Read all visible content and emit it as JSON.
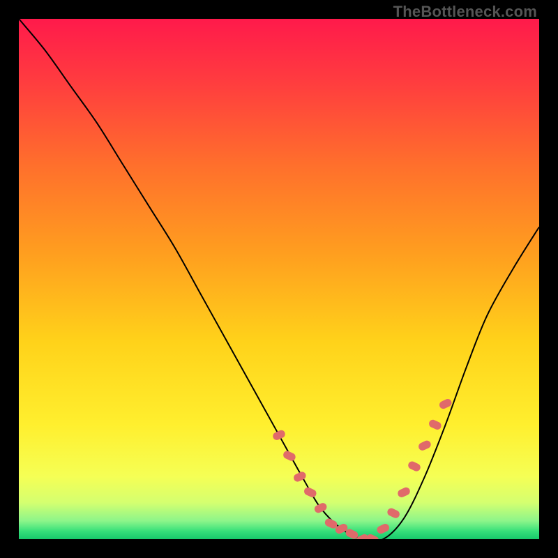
{
  "watermark": "TheBottleneck.com",
  "chart_data": {
    "type": "line",
    "title": "",
    "xlabel": "",
    "ylabel": "",
    "xlim": [
      0,
      100
    ],
    "ylim": [
      0,
      100
    ],
    "grid": false,
    "legend": false,
    "background": {
      "kind": "vertical-gradient",
      "stops": [
        {
          "pos": 0.0,
          "color": "#ff1a4b"
        },
        {
          "pos": 0.12,
          "color": "#ff3c3f"
        },
        {
          "pos": 0.28,
          "color": "#ff6f2c"
        },
        {
          "pos": 0.45,
          "color": "#ff9e1f"
        },
        {
          "pos": 0.62,
          "color": "#ffd21a"
        },
        {
          "pos": 0.78,
          "color": "#ffef2e"
        },
        {
          "pos": 0.88,
          "color": "#f5ff55"
        },
        {
          "pos": 0.93,
          "color": "#d4ff70"
        },
        {
          "pos": 0.965,
          "color": "#8cf58a"
        },
        {
          "pos": 0.985,
          "color": "#35e07a"
        },
        {
          "pos": 1.0,
          "color": "#17c96b"
        }
      ]
    },
    "series": [
      {
        "name": "curve",
        "color": "#000000",
        "width": 2,
        "x": [
          0,
          5,
          10,
          15,
          20,
          25,
          30,
          35,
          40,
          45,
          50,
          55,
          58,
          62,
          66,
          70,
          74,
          78,
          82,
          86,
          90,
          95,
          100
        ],
        "values": [
          100,
          94,
          87,
          80,
          72,
          64,
          56,
          47,
          38,
          29,
          20,
          11,
          6,
          2,
          0,
          0,
          4,
          12,
          22,
          33,
          43,
          52,
          60
        ]
      },
      {
        "name": "marker-band",
        "kind": "markers",
        "color": "#e06a6a",
        "size": 14,
        "x": [
          50,
          52,
          54,
          56,
          58,
          60,
          62,
          64,
          66,
          68,
          70,
          72,
          74,
          76,
          78,
          80,
          82
        ],
        "values": [
          20,
          16,
          12,
          9,
          6,
          3,
          2,
          1,
          0,
          0,
          2,
          5,
          9,
          14,
          18,
          22,
          26
        ]
      }
    ]
  }
}
